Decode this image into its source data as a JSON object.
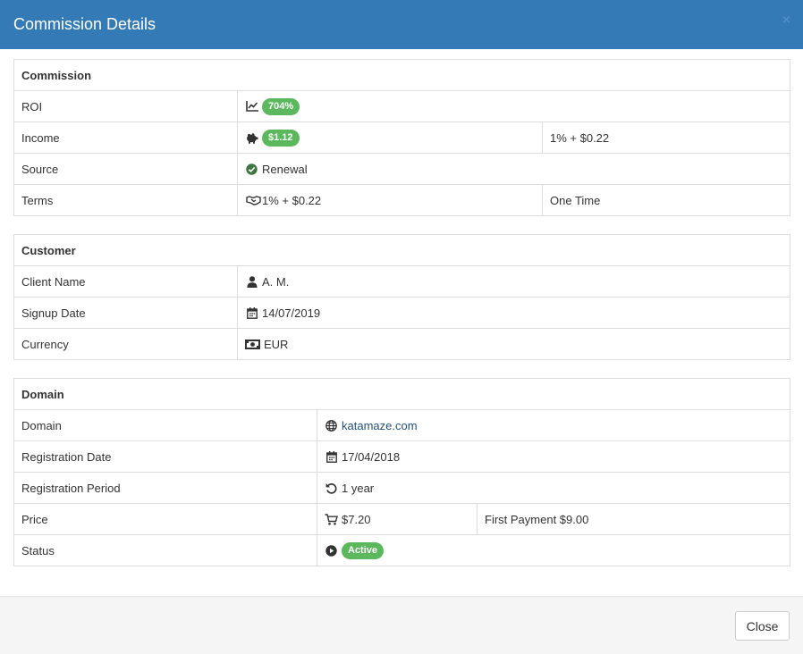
{
  "modal": {
    "title": "Commission Details",
    "close_symbol": "×",
    "close_button_label": "Close"
  },
  "commission": {
    "heading": "Commission",
    "rows": {
      "roi": {
        "label": "ROI",
        "icon": "chart-line-icon",
        "badge": "704%"
      },
      "income": {
        "label": "Income",
        "icon": "piggy-bank-icon",
        "badge": "$1.12",
        "extra": "1% + $0.22"
      },
      "source": {
        "label": "Source",
        "icon": "check-circle-icon",
        "value": "Renewal"
      },
      "terms": {
        "label": "Terms",
        "icon": "handshake-icon",
        "value": "1% + $0.22",
        "extra": "One Time"
      }
    }
  },
  "customer": {
    "heading": "Customer",
    "rows": {
      "client_name": {
        "label": "Client Name",
        "icon": "user-icon",
        "value": "A. M."
      },
      "signup_date": {
        "label": "Signup Date",
        "icon": "calendar-icon",
        "value": "14/07/2019"
      },
      "currency": {
        "label": "Currency",
        "icon": "money-bill-icon",
        "value": "EUR"
      }
    }
  },
  "domain": {
    "heading": "Domain",
    "rows": {
      "domain": {
        "label": "Domain",
        "icon": "globe-icon",
        "value": "katamaze.com"
      },
      "registration_date": {
        "label": "Registration Date",
        "icon": "calendar-icon",
        "value": "17/04/2018"
      },
      "registration_period": {
        "label": "Registration Period",
        "icon": "undo-icon",
        "value": "1 year"
      },
      "price": {
        "label": "Price",
        "icon": "cart-icon",
        "value": "$7.20",
        "extra": "First Payment $9.00"
      },
      "status": {
        "label": "Status",
        "icon": "play-circle-icon",
        "badge": "Active"
      }
    }
  },
  "colors": {
    "header_bg": "#337ab7",
    "badge_green": "#5cb85c",
    "link": "#23527c",
    "border": "#dddddd",
    "footer_bg": "#f5f5f5"
  }
}
